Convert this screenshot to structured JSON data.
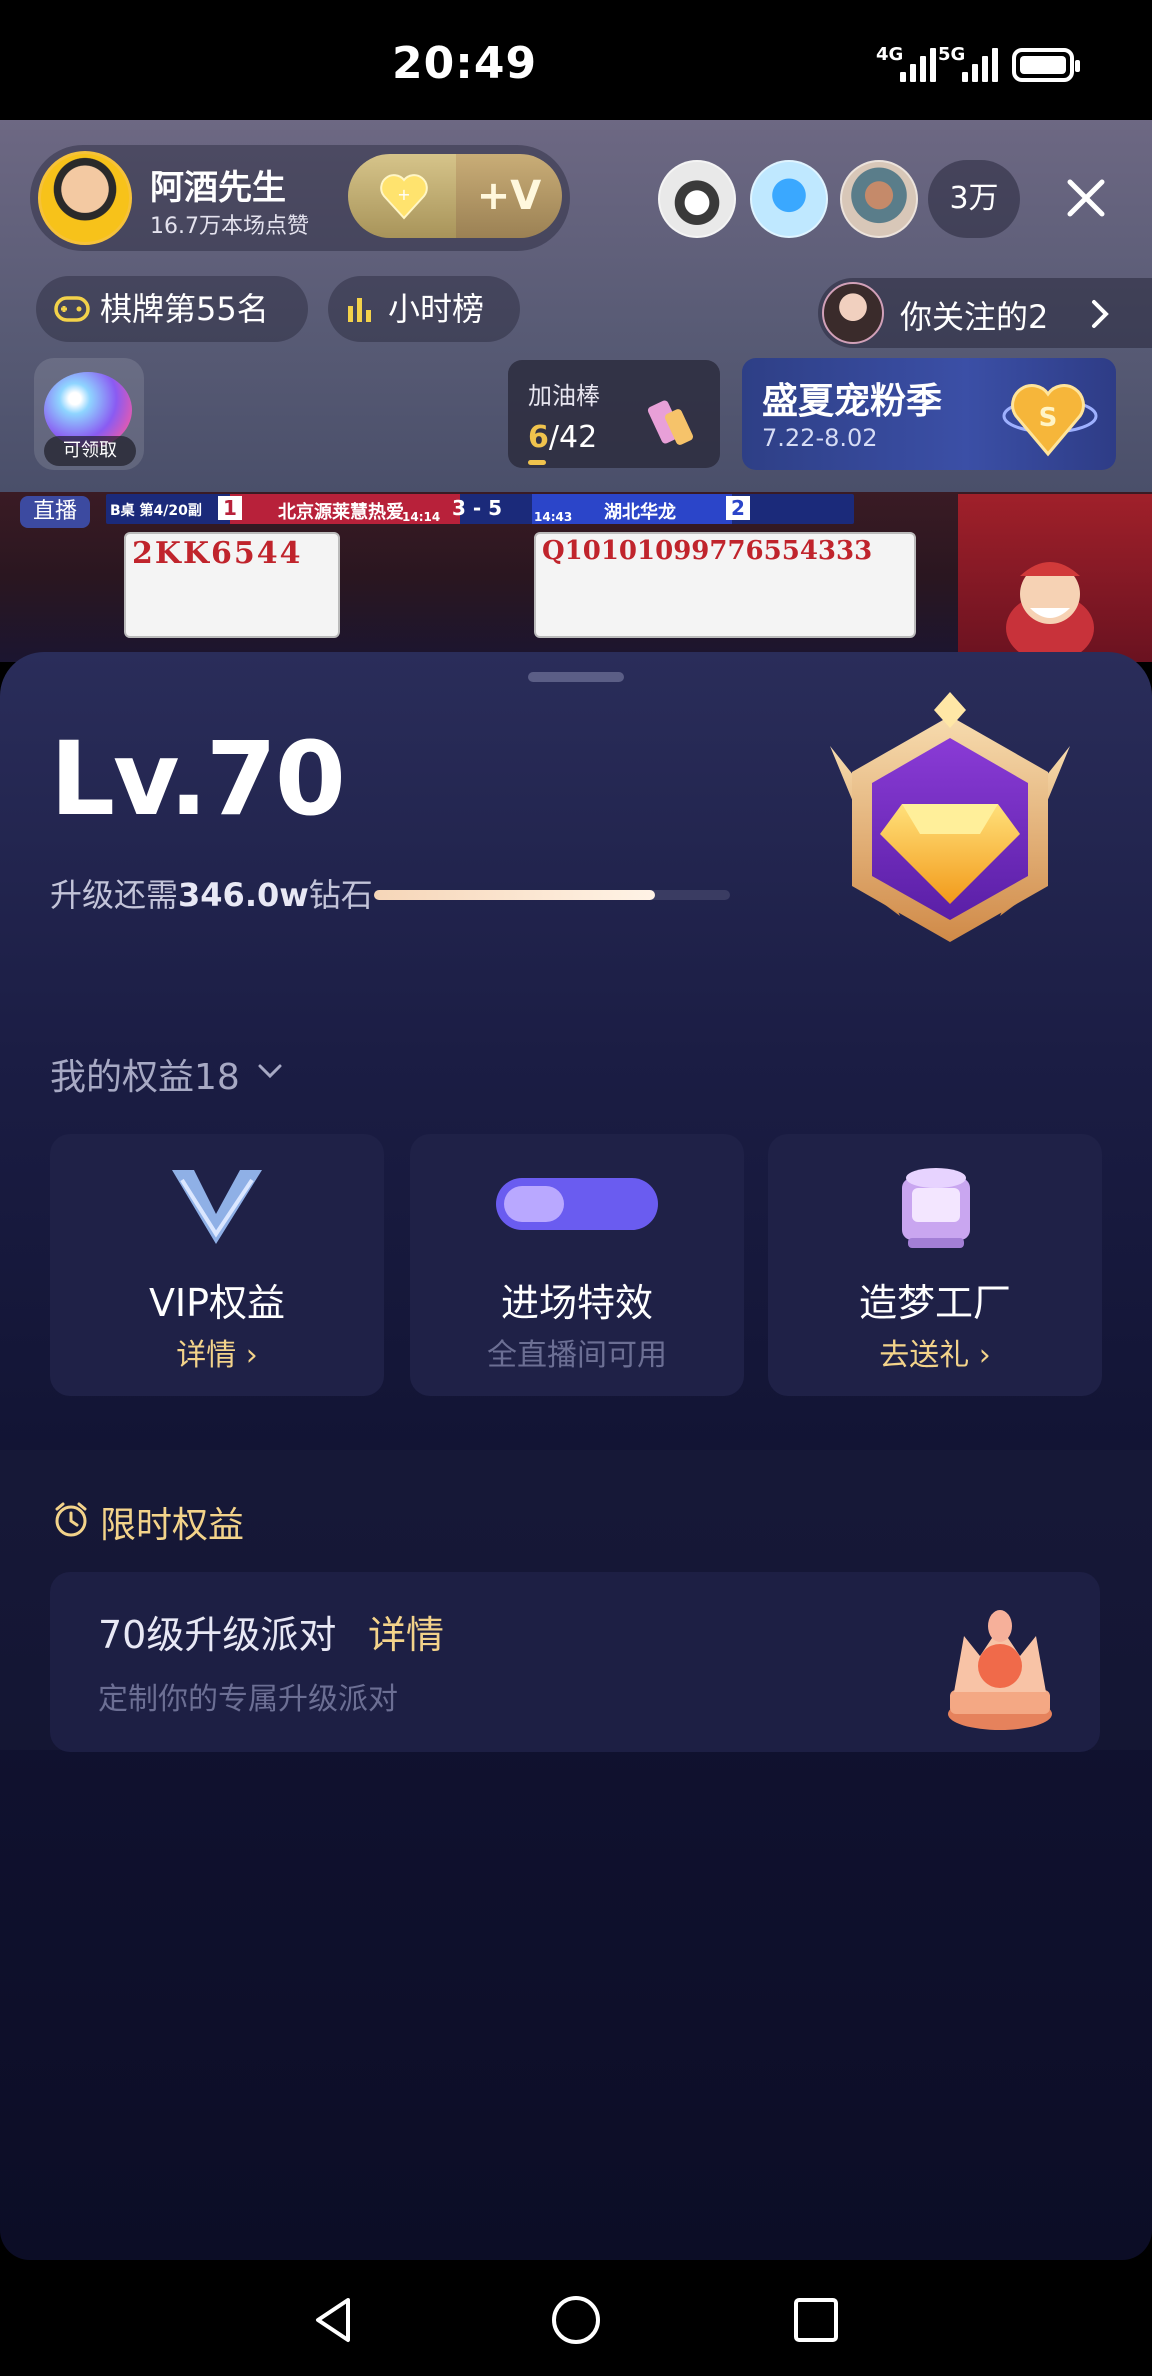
{
  "status": {
    "time": "20:49",
    "net1": "4G",
    "net2": "5G"
  },
  "host": {
    "name": "阿酒先生",
    "likes": "16.7万本场点赞",
    "vip_label": "+V"
  },
  "viewers": {
    "count": "3万"
  },
  "chips": {
    "rank": "棋牌第55名",
    "hourly": "小时榜"
  },
  "follow": {
    "text": "你关注的2"
  },
  "claim": {
    "label": "可领取"
  },
  "cheer": {
    "title": "加油棒",
    "current": "6",
    "total": "/42"
  },
  "summer": {
    "title": "盛夏宠粉季",
    "dates": "7.22-8.02"
  },
  "stream": {
    "live_tag": "直播",
    "stage": "B桌 第4/20副",
    "team_left_seat": "1",
    "team_left": "北京源莱慧热爱",
    "time_left": "14:14",
    "score": "3 - 5",
    "time_right": "14:43",
    "team_right": "湖北华龙",
    "team_right_seat": "2",
    "cards_left": "2KK6544",
    "cards_right": "Q10101099776554333"
  },
  "sheet": {
    "level": "Lv.70",
    "upgrade_prefix": "升级还需",
    "upgrade_amount": "346.0w",
    "upgrade_suffix": "钻石",
    "upgrade_progress": 0.79,
    "rights_title": "我的权益18",
    "tiles": [
      {
        "label": "VIP权益",
        "sub": "详情 ›"
      },
      {
        "label": "进场特效",
        "sub": "全直播间可用"
      },
      {
        "label": "造梦工厂",
        "sub": "去送礼 ›"
      }
    ],
    "limited_title": "限时权益",
    "party_title": "70级升级派对",
    "party_detail": "详情",
    "party_desc": "定制你的专属升级派对"
  },
  "colors": {
    "gold": "#f3d38a",
    "sheet_top": "#2a2d5a",
    "sheet_bottom": "#0c0d26"
  }
}
